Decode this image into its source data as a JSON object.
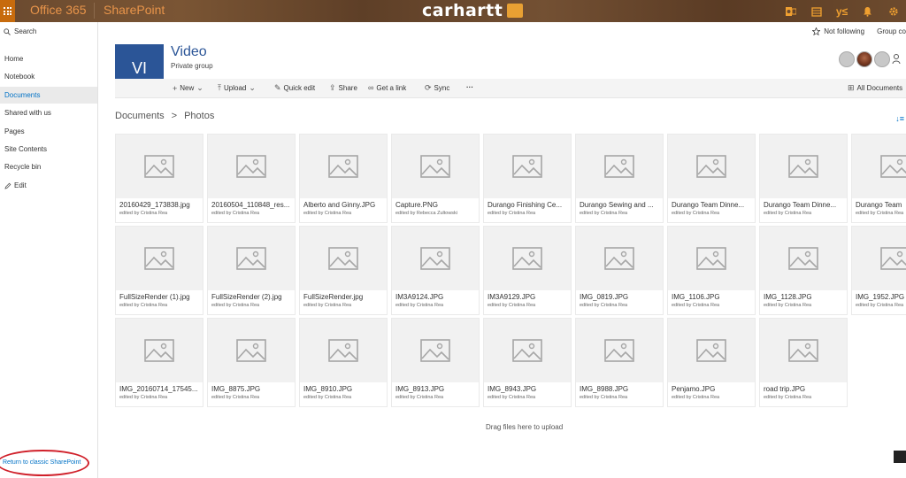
{
  "suitebar": {
    "app_name": "Office 365",
    "product": "SharePoint",
    "brand": "carhartt",
    "icons": [
      "outlook-icon",
      "calendar-icon",
      "yammer-icon",
      "bell-icon",
      "gear-icon"
    ],
    "yammer_glyph": "y≤"
  },
  "leftnav": {
    "search_label": "Search",
    "items": [
      {
        "label": "Home"
      },
      {
        "label": "Notebook"
      },
      {
        "label": "Documents",
        "active": true
      },
      {
        "label": "Shared with us"
      },
      {
        "label": "Pages"
      },
      {
        "label": "Site Contents"
      },
      {
        "label": "Recycle bin"
      }
    ],
    "edit_label": "Edit",
    "return_link": "Return to classic SharePoint"
  },
  "header": {
    "logo_text": "VI",
    "title": "Video",
    "subtitle": "Private group",
    "follow_label": "Not following",
    "group_label": "Group co"
  },
  "commands": {
    "new": "New",
    "upload": "Upload",
    "quick_edit": "Quick edit",
    "share": "Share",
    "get_link": "Get a link",
    "sync": "Sync",
    "more": "···",
    "view": "All Documents"
  },
  "breadcrumb": {
    "root": "Documents",
    "separator": ">",
    "current": "Photos"
  },
  "files": [
    {
      "name": "20160429_173838.jpg",
      "editor": "edited by Cristina Rea"
    },
    {
      "name": "20160504_110848_res...",
      "editor": "edited by Cristina Rea"
    },
    {
      "name": "Alberto and Ginny.JPG",
      "editor": "edited by Cristina Rea"
    },
    {
      "name": "Capture.PNG",
      "editor": "edited by Rebecca Zultowski"
    },
    {
      "name": "Durango Finishing Ce...",
      "editor": "edited by Cristina Rea"
    },
    {
      "name": "Durango Sewing and ...",
      "editor": "edited by Cristina Rea"
    },
    {
      "name": "Durango Team Dinne...",
      "editor": "edited by Cristina Rea"
    },
    {
      "name": "Durango Team Dinne...",
      "editor": "edited by Cristina Rea"
    },
    {
      "name": "Durango Team",
      "editor": "edited by Cristina Rea"
    },
    {
      "name": "FullSizeRender (1).jpg",
      "editor": "edited by Cristina Rea"
    },
    {
      "name": "FullSizeRender (2).jpg",
      "editor": "edited by Cristina Rea"
    },
    {
      "name": "FullSizeRender.jpg",
      "editor": "edited by Cristina Rea"
    },
    {
      "name": "IM3A9124.JPG",
      "editor": "edited by Cristina Rea"
    },
    {
      "name": "IM3A9129.JPG",
      "editor": "edited by Cristina Rea"
    },
    {
      "name": "IMG_0819.JPG",
      "editor": "edited by Cristina Rea"
    },
    {
      "name": "IMG_1106.JPG",
      "editor": "edited by Cristina Rea"
    },
    {
      "name": "IMG_1128.JPG",
      "editor": "edited by Cristina Rea"
    },
    {
      "name": "IMG_1952.JPG",
      "editor": "edited by Cristina Rea"
    },
    {
      "name": "IMG_20160714_17545...",
      "editor": "edited by Cristina Rea"
    },
    {
      "name": "IMG_8875.JPG",
      "editor": "edited by Cristina Rea"
    },
    {
      "name": "IMG_8910.JPG",
      "editor": "edited by Cristina Rea"
    },
    {
      "name": "IMG_8913.JPG",
      "editor": "edited by Cristina Rea"
    },
    {
      "name": "IMG_8943.JPG",
      "editor": "edited by Cristina Rea"
    },
    {
      "name": "IMG_8988.JPG",
      "editor": "edited by Cristina Rea"
    },
    {
      "name": "Penjamo.JPG",
      "editor": "edited by Cristina Rea"
    },
    {
      "name": "road trip.JPG",
      "editor": "edited by Cristina Rea"
    }
  ],
  "dropzone_text": "Drag files here to upload",
  "colors": {
    "accent": "#0072c6",
    "site_logo": "#2b5597",
    "suite_orange": "#c76b0d",
    "annotation_red": "#d0202a"
  }
}
